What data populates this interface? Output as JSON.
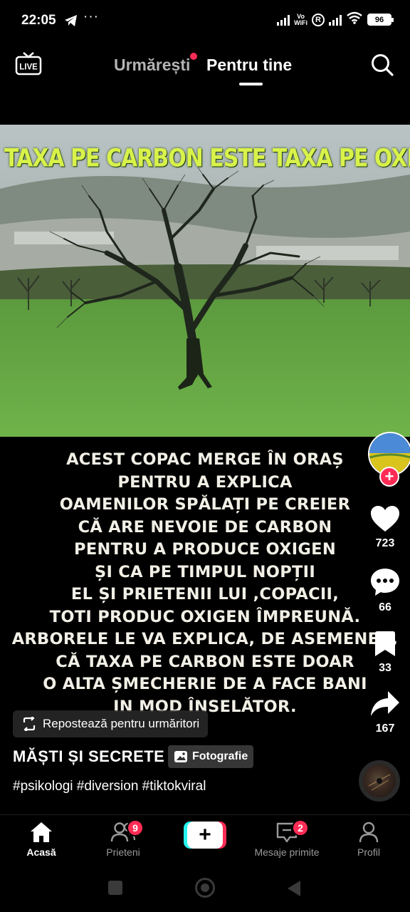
{
  "status_bar": {
    "time": "22:05",
    "notification_icon": "telegram-icon",
    "overflow": "···",
    "vowifi": "Vo\nWiFi",
    "roaming": "R",
    "battery": "96"
  },
  "top_nav": {
    "live_label": "LIVE",
    "tab_following": "Urmărești",
    "tab_for_you": "Pentru tine",
    "active_tab": "Pentru tine",
    "search_icon": "search-icon"
  },
  "post": {
    "image_headline": "TAXA PE CARBON ESTE TAXA PE OXIGEN !!!",
    "meme_lines": [
      "ACEST COPAC MERGE ÎN ORAȘ",
      "PENTRU A EXPLICA",
      "OAMENILOR SPĂLAȚI PE CREIER",
      "CĂ ARE NEVOIE DE CARBON",
      "PENTRU A PRODUCE OXIGEN",
      "ȘI CA PE TIMPUL NOPȚII",
      "EL ȘI PRIETENII LUI ,COPACII,",
      "TOTI PRODUC OXIGEN ÎMPREUNĂ.",
      "ARBORELE LE VA EXPLICA, DE ASEMENEA,",
      "CĂ TAXA PE CARBON ESTE DOAR",
      "O ALTA ȘMECHERIE DE A FACE BANI",
      "IN MOD ÎNSELĂTOR."
    ]
  },
  "rail": {
    "follow_plus": "+",
    "likes": "723",
    "comments": "66",
    "saves": "33",
    "shares": "167"
  },
  "info": {
    "repost_label": "Repostează pentru urmăritori",
    "author": "MĂȘTI  ȘI SECRETE",
    "photo_chip": "Fotografie",
    "hashtags": "#psikologi #diversion #tiktokviral"
  },
  "bottom_nav": {
    "home": "Acasă",
    "friends": "Prieteni",
    "friends_badge": "9",
    "create": "+",
    "inbox": "Mesaje primite",
    "inbox_badge": "2",
    "profile": "Profil"
  },
  "colors": {
    "accent_red": "#fe2c55",
    "accent_cyan": "#25f4ee",
    "headline_green": "#d9f24a"
  }
}
